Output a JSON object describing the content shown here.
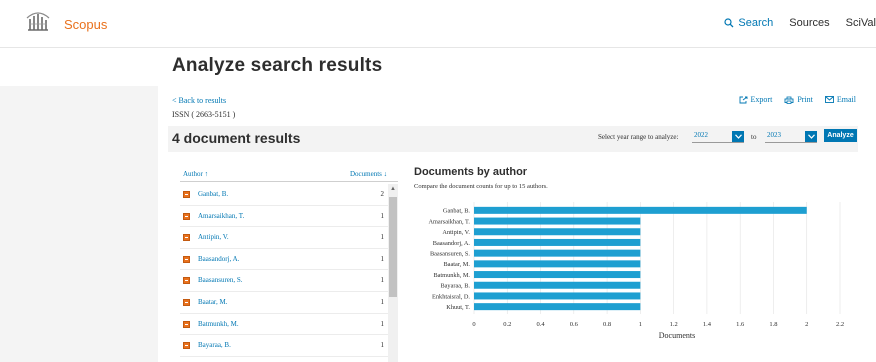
{
  "header": {
    "brand": "Scopus",
    "nav": [
      {
        "label": "Search",
        "icon": "search-icon"
      },
      {
        "label": "Sources"
      },
      {
        "label": "SciVal"
      }
    ]
  },
  "page": {
    "title": "Analyze search results",
    "back_link": "< Back to results",
    "issn": "ISSN ( 2663-5151 )",
    "actions": [
      {
        "label": "Export",
        "icon": "export-icon"
      },
      {
        "label": "Print",
        "icon": "print-icon"
      },
      {
        "label": "Email",
        "icon": "email-icon"
      }
    ]
  },
  "results": {
    "count_label": "4 document results",
    "range_label": "Select year range to analyze:",
    "year_start": "2022",
    "to_label": "to",
    "year_end": "2023",
    "analyze_label": "Analyze"
  },
  "author_table": {
    "author_header": "Author ↑",
    "documents_header": "Documents ↓",
    "rows": [
      {
        "name": "Ganbat, B.",
        "count": "2"
      },
      {
        "name": "Amarsaikhan, T.",
        "count": "1"
      },
      {
        "name": "Antipin, V.",
        "count": "1"
      },
      {
        "name": "Baasandorj, A.",
        "count": "1"
      },
      {
        "name": "Baasansuren, S.",
        "count": "1"
      },
      {
        "name": "Baatar, M.",
        "count": "1"
      },
      {
        "name": "Batmunkh, M.",
        "count": "1"
      },
      {
        "name": "Bayaraa, B.",
        "count": "1"
      }
    ]
  },
  "chart": {
    "title": "Documents by author",
    "subtitle": "Compare the document counts for up to 15 authors."
  },
  "colors": {
    "accent": "#0077b3",
    "brand": "#e9711c",
    "bar": "#1e9fd1"
  },
  "chart_data": {
    "type": "bar",
    "orientation": "horizontal",
    "categories": [
      "Ganbat, B.",
      "Amarsaikhan, T.",
      "Antipin, V.",
      "Baasandorj, A.",
      "Baasansuren, S.",
      "Baatar, M.",
      "Batmunkh, M.",
      "Bayaraa, B.",
      "Enkhtaisral, D.",
      "Khuut, T."
    ],
    "values": [
      2,
      1,
      1,
      1,
      1,
      1,
      1,
      1,
      1,
      1
    ],
    "xlabel": "Documents",
    "xticks": [
      "0",
      "0.2",
      "0.4",
      "0.6",
      "0.8",
      "1",
      "1.2",
      "1.4",
      "1.6",
      "1.8",
      "2",
      "2.2"
    ],
    "xlim": [
      0,
      2.2
    ],
    "grid": true
  }
}
